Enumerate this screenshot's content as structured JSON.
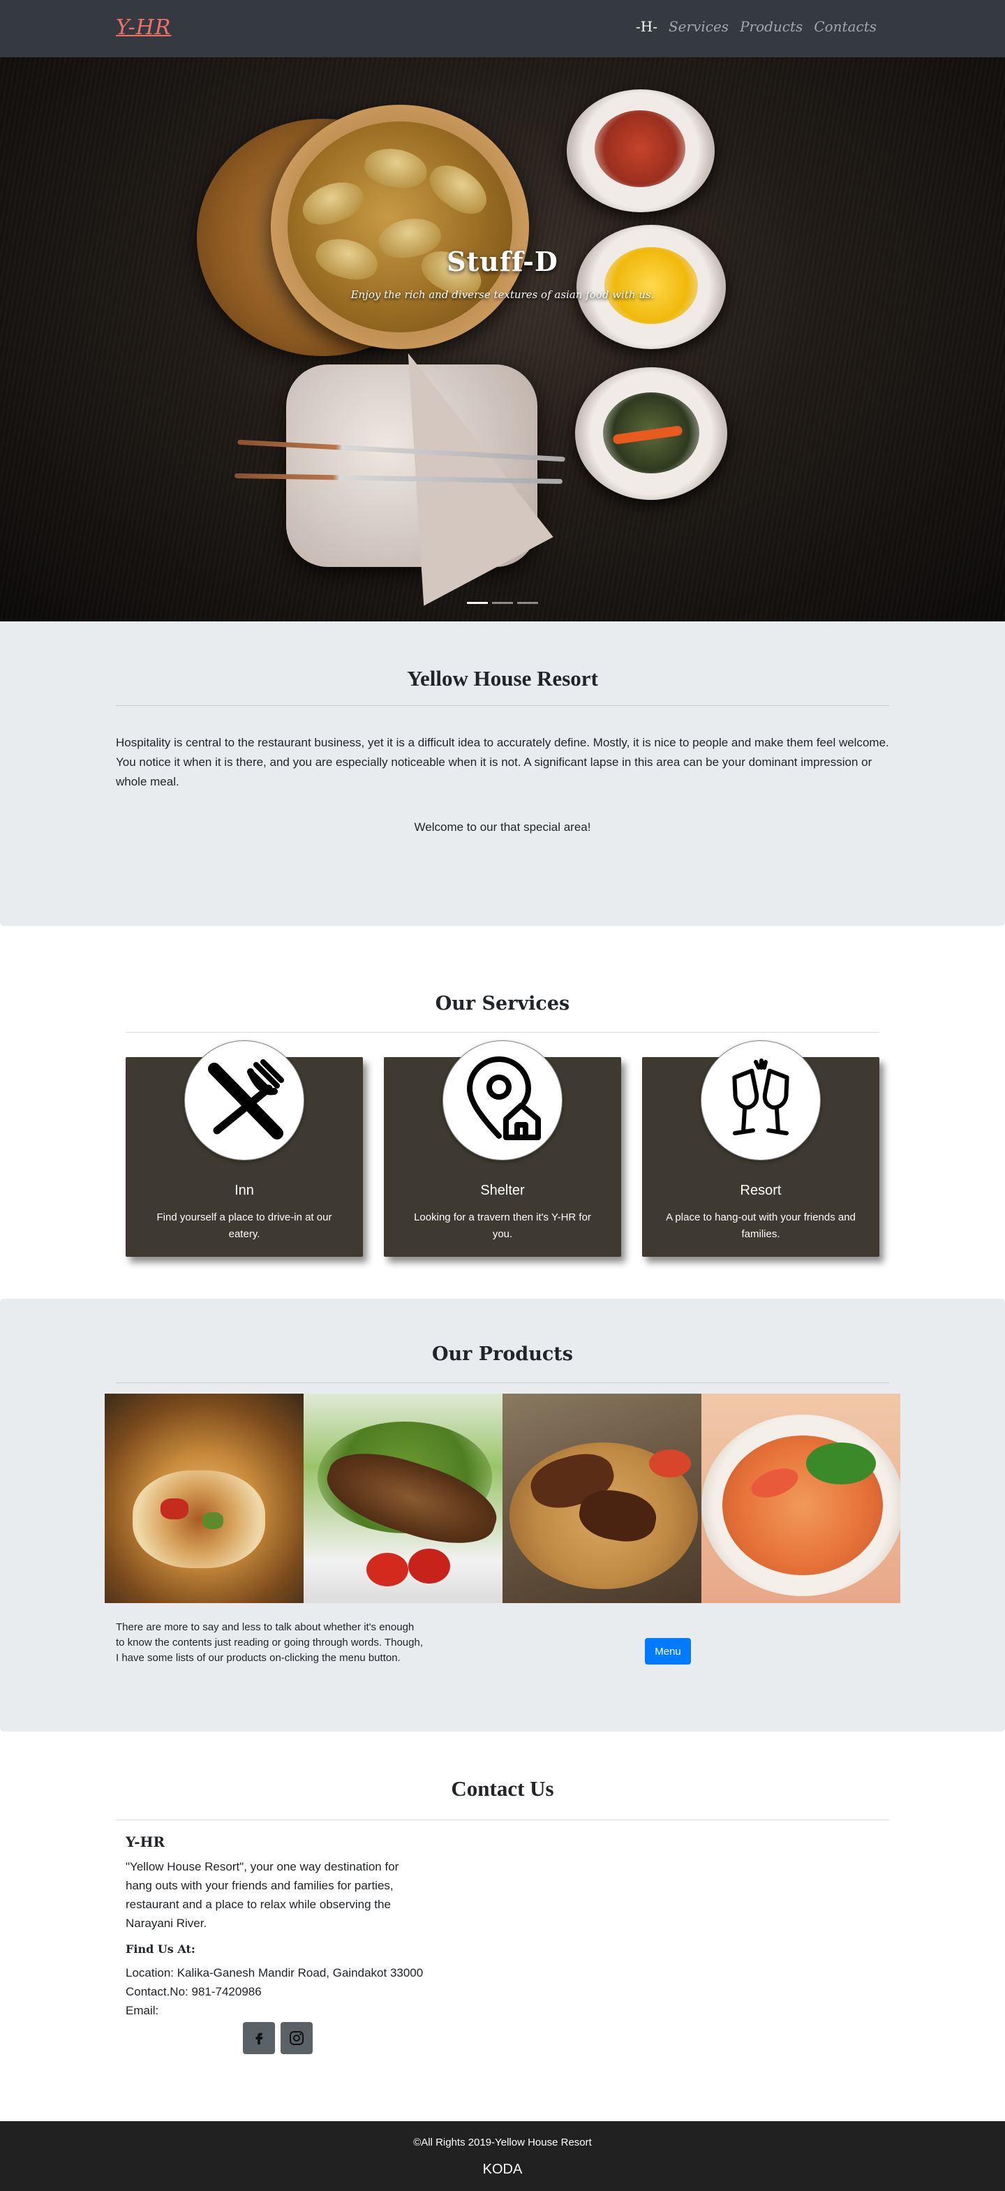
{
  "navbar": {
    "brand": "Y-HR",
    "links": [
      "-H-",
      "Services",
      "Products",
      "Contacts"
    ]
  },
  "hero": {
    "title": "Stuff-D",
    "subtitle": "Enjoy the rich and diverse textures of asian food with us.",
    "slides": 3,
    "active_slide": 1
  },
  "about": {
    "title": "Yellow House Resort",
    "paragraph": "Hospitality is central to the restaurant business, yet it is a difficult idea to accurately define. Mostly, it is nice to people and make them feel welcome. You notice it when it is there, and you are especially noticeable when it is not. A significant lapse in this area can be your dominant impression or whole meal.",
    "welcome": "Welcome to our that special area!"
  },
  "services": {
    "title": "Our Services",
    "items": [
      {
        "name": "Inn",
        "description": "Find yourself a place to drive-in at our eatery.",
        "icon": "utensils-icon"
      },
      {
        "name": "Shelter",
        "description": "Looking for a travern then it's Y-HR for you.",
        "icon": "location-home-icon"
      },
      {
        "name": "Resort",
        "description": "A place to hang-out with your friends and families.",
        "icon": "wine-glasses-icon"
      }
    ]
  },
  "products": {
    "title": "Our Products",
    "images": [
      "burrito-image",
      "grilled-fish-salad-image",
      "chicken-biryani-image",
      "noodle-soup-image"
    ],
    "text": "There are more to say and less to talk about whether it's enough to know the contents just reading or going through words. Though, I have some lists of our products on-clicking the menu button.",
    "menu_button": "Menu"
  },
  "contact": {
    "title": "Contact Us",
    "brand": "Y-HR",
    "description": "\"Yellow House Resort\", your one way destination for hang outs with your friends and families for parties, restaurant and a place to relax while observing the Narayani River.",
    "find_title": "Find Us At:",
    "location": "Location: Kalika-Ganesh Mandir Road, Gaindakot 33000",
    "phone": "Contact.No: 981-7420986",
    "email": "Email:",
    "social": [
      "facebook-icon",
      "instagram-icon"
    ]
  },
  "footer": {
    "copyright": "©All Rights 2019-Yellow House Resort",
    "brand": "KODA"
  },
  "colors": {
    "navbar": "#343a40",
    "brand": "#f07167",
    "section_gray": "#e9ecef",
    "card": "#3e3a31",
    "button": "#007bff",
    "footer": "#212121"
  }
}
